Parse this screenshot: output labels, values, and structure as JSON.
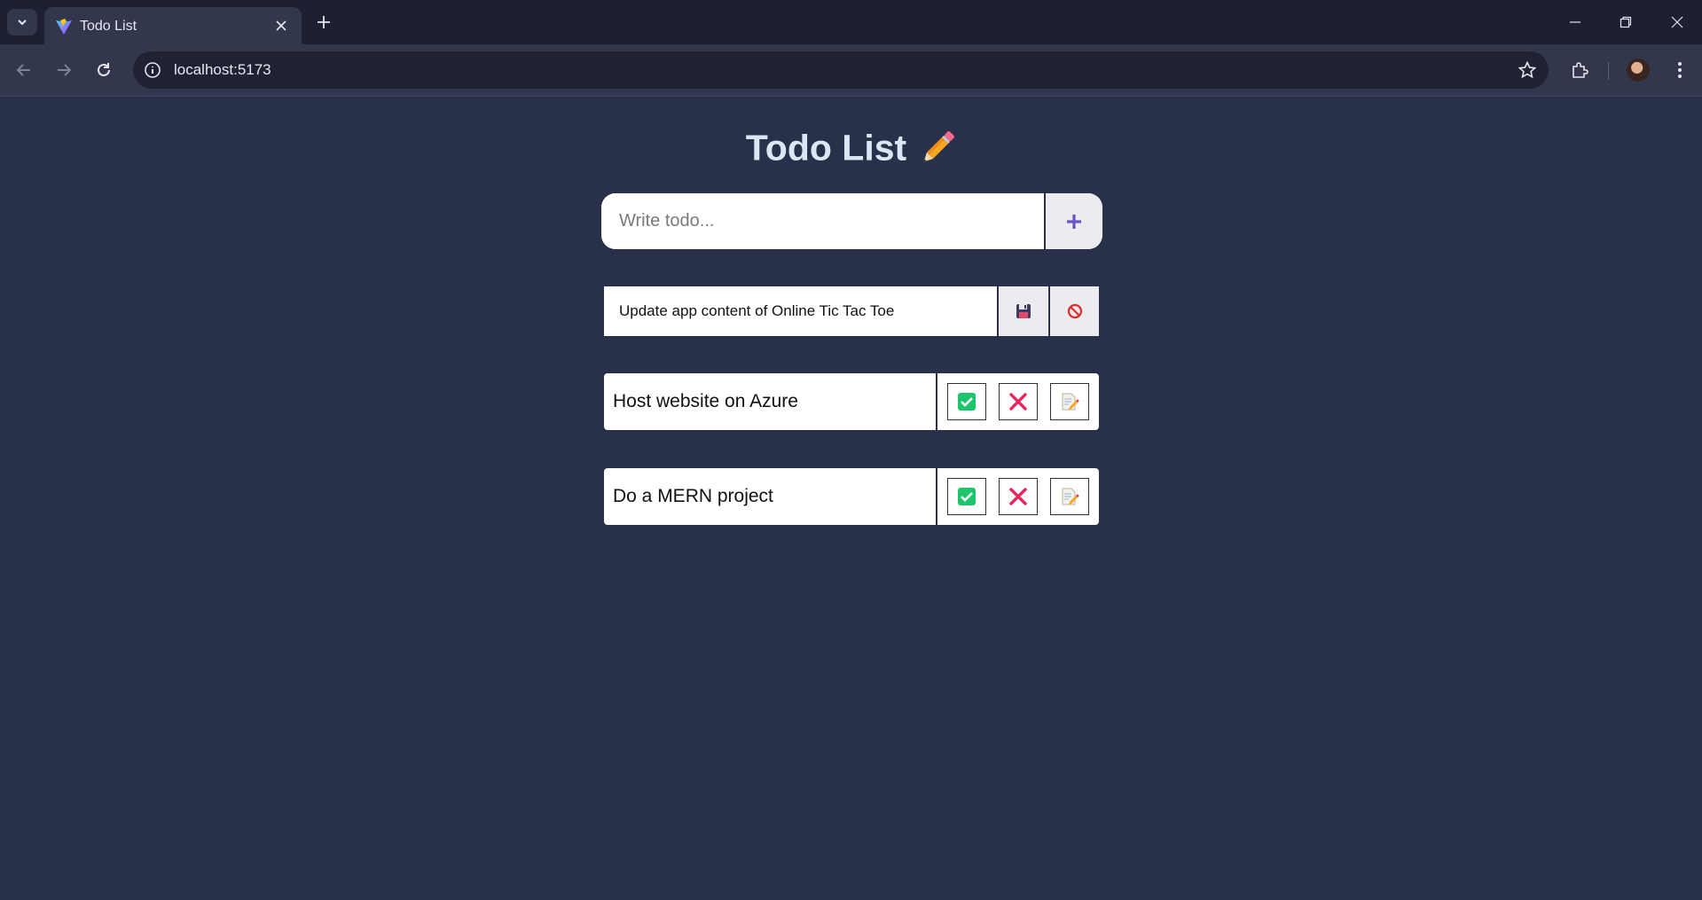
{
  "browser": {
    "tab_title": "Todo List",
    "url": "localhost:5173"
  },
  "app": {
    "title": "Todo List",
    "title_emoji": "pencil-icon",
    "add_placeholder": "Write todo...",
    "add_icon": "plus-icon",
    "editing": {
      "value": "Update app content of Online Tic Tac Toe",
      "save_icon": "floppy-disk-icon",
      "cancel_icon": "prohibited-icon"
    },
    "todos": [
      {
        "text": "Host website on Azure"
      },
      {
        "text": "Do a MERN project"
      }
    ],
    "colors": {
      "background": "#29304a",
      "title": "#dce6f4",
      "accent": "#6b52c8",
      "check": "#1cc46b",
      "delete": "#e8265e"
    }
  }
}
